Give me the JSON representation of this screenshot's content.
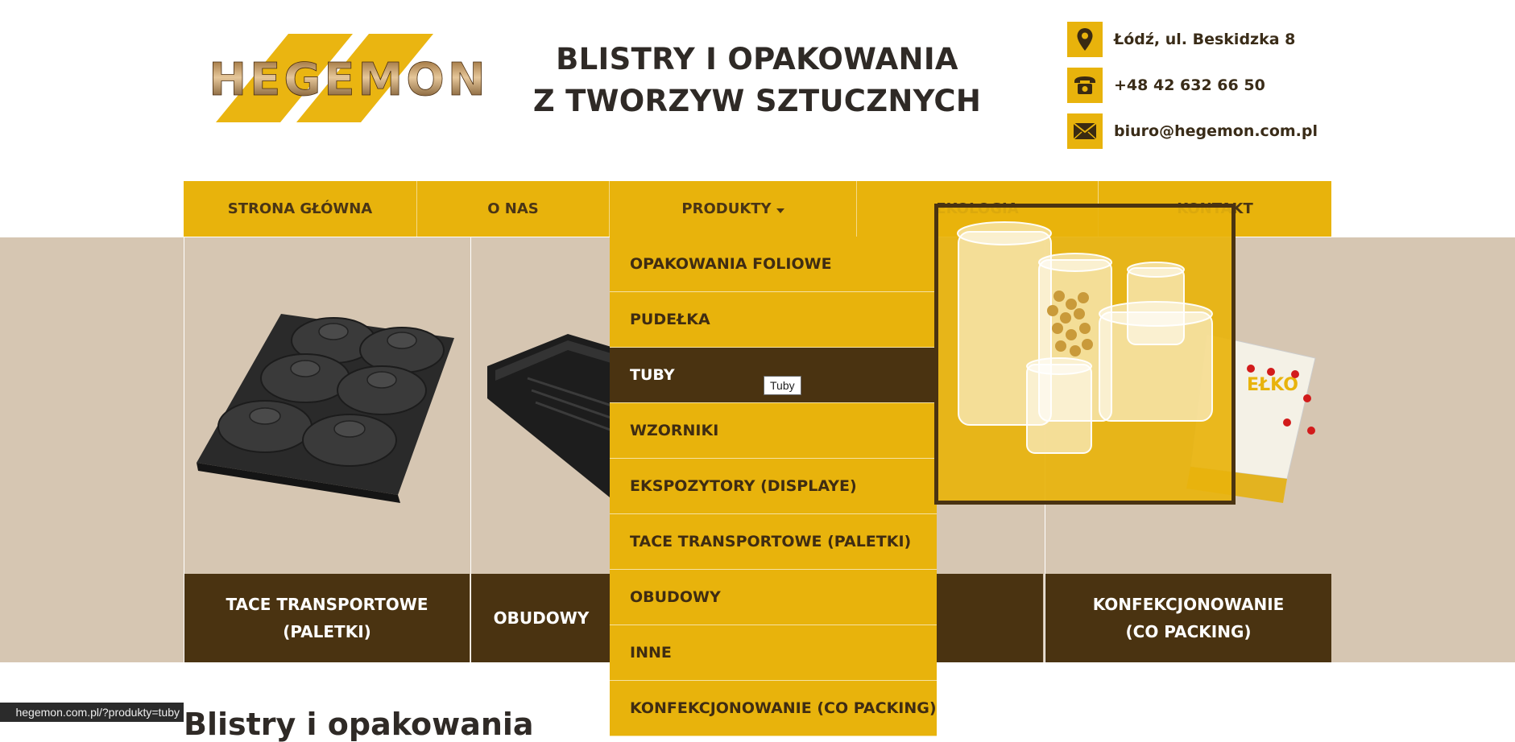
{
  "header": {
    "logo_text": "HEGEMON",
    "tagline_line1": "BLISTRY I OPAKOWANIA",
    "tagline_line2": "Z TWORZYW SZTUCZNYCH",
    "contact": {
      "address": "Łódź, ul. Beskidzka 8",
      "phone": "+48 42 632 66 50",
      "email": "biuro@hegemon.com.pl"
    }
  },
  "nav": {
    "items": [
      {
        "label": "STRONA GŁÓWNA"
      },
      {
        "label": "O NAS"
      },
      {
        "label": "PRODUKTY"
      },
      {
        "label": "EKOLOGIA"
      },
      {
        "label": "KONTAKT"
      }
    ]
  },
  "dropdown": {
    "items": [
      {
        "label": "OPAKOWANIA FOLIOWE"
      },
      {
        "label": "PUDEŁKA"
      },
      {
        "label": "TUBY"
      },
      {
        "label": "WZORNIKI"
      },
      {
        "label": "EKSPOZYTORY (DISPLAYE)"
      },
      {
        "label": "TACE TRANSPORTOWE (PALETKI)"
      },
      {
        "label": "OBUDOWY"
      },
      {
        "label": "INNE"
      },
      {
        "label": "KONFEKCJONOWANIE (CO PACKING)"
      }
    ],
    "active_index": 2,
    "tooltip": "Tuby"
  },
  "cards": [
    {
      "line1": "TACE TRANSPORTOWE",
      "line2": "(PALETKI)"
    },
    {
      "line1": "OBUDOWY",
      "line2": ""
    },
    {
      "line1": "",
      "line2": ""
    },
    {
      "line1": "",
      "line2": ""
    },
    {
      "line1": "KONFEKCJONOWANIE",
      "line2": "(CO PACKING)"
    }
  ],
  "card_partial_art": "EŁKO",
  "section_heading": "Blistry i opakowania",
  "status_bar_url": "hegemon.com.pl/?produkty=tuby",
  "colors": {
    "accent": "#e8b30c",
    "dark_brown": "#4a3311",
    "band_beige": "#d6c6b2",
    "text_dark": "#2f2a26"
  },
  "icons": {
    "address": "map-pin-icon",
    "phone": "phone-icon",
    "email": "envelope-icon",
    "nav_dropdown": "caret-down-icon"
  }
}
